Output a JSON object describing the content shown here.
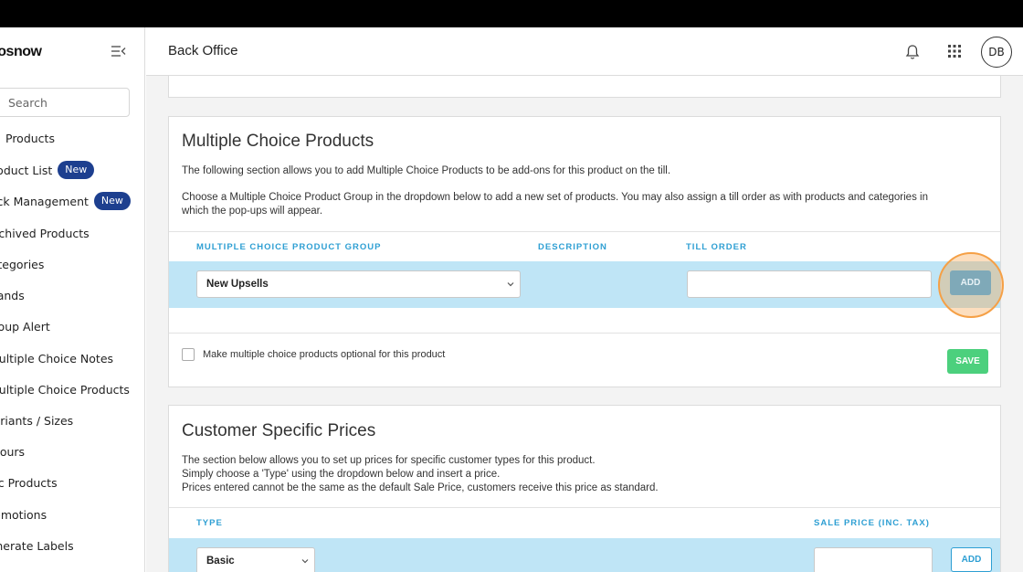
{
  "app": {
    "logo_text": "posnow",
    "page_title": "Back Office",
    "user_initials": "DB"
  },
  "sidebar": {
    "search_placeholder": "Search",
    "items": [
      {
        "label": "Products",
        "badge": ""
      },
      {
        "label": "Product List",
        "badge": "New"
      },
      {
        "label": "Stock Management",
        "badge": "New"
      },
      {
        "label": "Archived Products",
        "badge": ""
      },
      {
        "label": "Categories",
        "badge": ""
      },
      {
        "label": "Brands",
        "badge": ""
      },
      {
        "label": "Group Alert",
        "badge": ""
      },
      {
        "label": "Multiple Choice Notes",
        "badge": ""
      },
      {
        "label": "Multiple Choice Products",
        "badge": ""
      },
      {
        "label": "Variants / Sizes",
        "badge": ""
      },
      {
        "label": "Colours",
        "badge": ""
      },
      {
        "label": "Misc Products",
        "badge": ""
      },
      {
        "label": "Promotions",
        "badge": ""
      },
      {
        "label": "Generate Labels",
        "badge": ""
      }
    ]
  },
  "multiple_choice": {
    "title": "Multiple Choice Products",
    "desc1": "The following section allows you to add Multiple Choice Products to be add-ons for this product on the till.",
    "desc2a": "Choose a Multiple Choice Product Group in the dropdown below to add a new set of products. You may also assign a till order as with products and categories in",
    "desc2b": "which the pop-ups will appear.",
    "col_group": "MULTIPLE CHOICE PRODUCT GROUP",
    "col_description": "DESCRIPTION",
    "col_till_order": "TILL ORDER",
    "group_selected": "New Upsells",
    "till_order_value": "",
    "add_label": "ADD",
    "optional_label": "Make multiple choice products optional for this product",
    "optional_checked": false,
    "save_label": "SAVE"
  },
  "customer_prices": {
    "title": "Customer Specific Prices",
    "desc1": "The section below allows you to set up prices for specific customer types for this product.",
    "desc2": "Simply choose a 'Type' using the dropdown below and insert a price.",
    "desc3": "Prices entered cannot be the same as the default Sale Price, customers receive this price as standard.",
    "col_type": "TYPE",
    "col_sale_price": "SALE PRICE (INC. TAX)",
    "type_selected": "Basic",
    "price_value": "",
    "add_label": "ADD"
  },
  "colors": {
    "accent": "#2e9fd3",
    "badge": "#1d3f8f",
    "row_highlight": "#bfe5f6",
    "save_green": "#4cd07d",
    "add_disabled": "#7fa9b8",
    "click_ring": "#f5a046"
  }
}
